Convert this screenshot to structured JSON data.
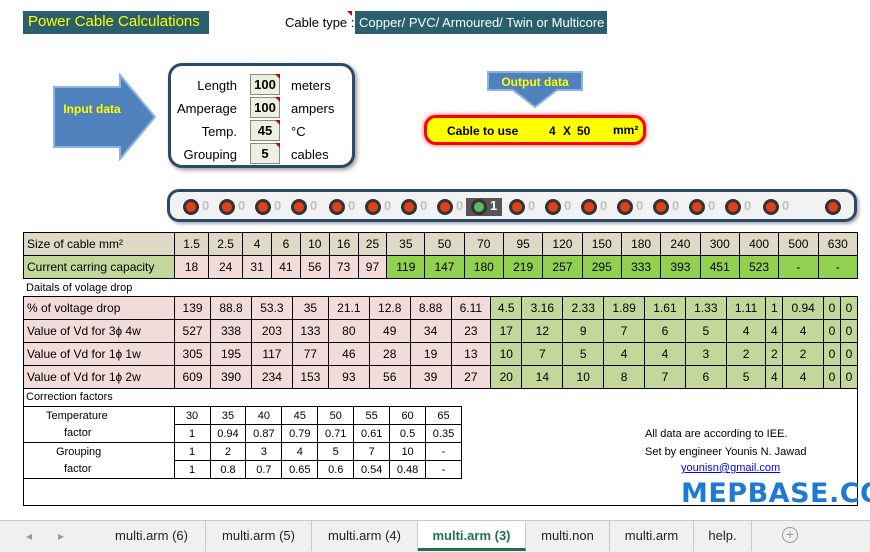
{
  "title": "Power Cable Calculations",
  "cable_type_label": "Cable type :",
  "cable_type_value": "Copper/ PVC/ Armoured/ Twin or Multicore",
  "input_arrow_label": "Input data",
  "output_arrow_label": "Output data",
  "inputs": [
    {
      "label": "Length",
      "value": "100",
      "unit": "meters"
    },
    {
      "label": "Amperage",
      "value": "100",
      "unit": "ampers"
    },
    {
      "label": "Temp.",
      "value": "45",
      "unit": "°C"
    },
    {
      "label": "Grouping",
      "value": "5",
      "unit": "cables"
    }
  ],
  "output": {
    "label": "Cable to use",
    "cores": "4",
    "x": "X",
    "size": "50",
    "unit": "mm²"
  },
  "slider": {
    "values": [
      "0",
      "0",
      "0",
      "0",
      "0",
      "0",
      "0",
      "0",
      "1",
      "0",
      "0",
      "0",
      "0",
      "0",
      "0",
      "0",
      "0"
    ],
    "active_index": 8
  },
  "table": {
    "size_label": "Size of cable mm²",
    "sizes": [
      "1.5",
      "2.5",
      "4",
      "6",
      "10",
      "16",
      "25",
      "35",
      "50",
      "70",
      "95",
      "120",
      "150",
      "180",
      "240",
      "300",
      "400",
      "500",
      "630"
    ],
    "capacity_label": "Current carring capacity",
    "capacity": [
      "18",
      "24",
      "31",
      "41",
      "56",
      "73",
      "97",
      "119",
      "147",
      "180",
      "219",
      "257",
      "295",
      "333",
      "393",
      "451",
      "523",
      "-",
      "-"
    ],
    "details_label": "Daitals of volage drop",
    "vdrop_label": "% of voltage drop",
    "vdrop": [
      "139",
      "88.8",
      "53.3",
      "35",
      "21.1",
      "12.8",
      "8.88",
      "6.11",
      "4.5",
      "3.16",
      "2.33",
      "1.89",
      "1.61",
      "1.33",
      "1.11",
      "1",
      "0.94",
      "0",
      "0"
    ],
    "vd3_label": "Value of Vd for 3ɸ 4w",
    "vd3": [
      "527",
      "338",
      "203",
      "133",
      "80",
      "49",
      "34",
      "23",
      "17",
      "12",
      "9",
      "7",
      "6",
      "5",
      "4",
      "4",
      "4",
      "0",
      "0"
    ],
    "vd1w_label": "Value of Vd for 1ɸ 1w",
    "vd1w": [
      "305",
      "195",
      "117",
      "77",
      "46",
      "28",
      "19",
      "13",
      "10",
      "7",
      "5",
      "4",
      "4",
      "3",
      "2",
      "2",
      "2",
      "0",
      "0"
    ],
    "vd2w_label": "Value of Vd for 1ɸ 2w",
    "vd2w": [
      "609",
      "390",
      "234",
      "153",
      "93",
      "56",
      "39",
      "27",
      "20",
      "14",
      "10",
      "8",
      "7",
      "6",
      "5",
      "4",
      "4",
      "0",
      "0"
    ]
  },
  "correction": {
    "label": "Correction factors",
    "temp_label": "Temperature",
    "factor_label": "factor",
    "temps": [
      "30",
      "35",
      "40",
      "45",
      "50",
      "55",
      "60",
      "65"
    ],
    "temp_factors": [
      "1",
      "0.94",
      "0.87",
      "0.79",
      "0.71",
      "0.61",
      "0.5",
      "0.35"
    ],
    "grouping_label": "Grouping",
    "groups": [
      "1",
      "2",
      "3",
      "4",
      "5",
      "7",
      "10",
      "-"
    ],
    "group_factors": [
      "1",
      "0.8",
      "0.7",
      "0.65",
      "0.6",
      "0.54",
      "0.48",
      "-"
    ]
  },
  "notes": {
    "line1": "All data are according to IEE.",
    "line2": "Set by engineer  Younis N. Jawad",
    "email": "younisn@gmail.com",
    "brand": "MEPBASE.COM"
  },
  "tabs": [
    "multi.arm (6)",
    "multi.arm (5)",
    "multi.arm (4)",
    "multi.arm (3)",
    "multi.non",
    "multi.arm",
    "help."
  ],
  "active_tab": 3,
  "colors": {
    "header_bg": "#2a5f6e",
    "accent_yellow": "#ffff00",
    "output_border": "#ff0000",
    "arrow_blue": "#4f81bd",
    "brand": "#1f7ad6"
  }
}
